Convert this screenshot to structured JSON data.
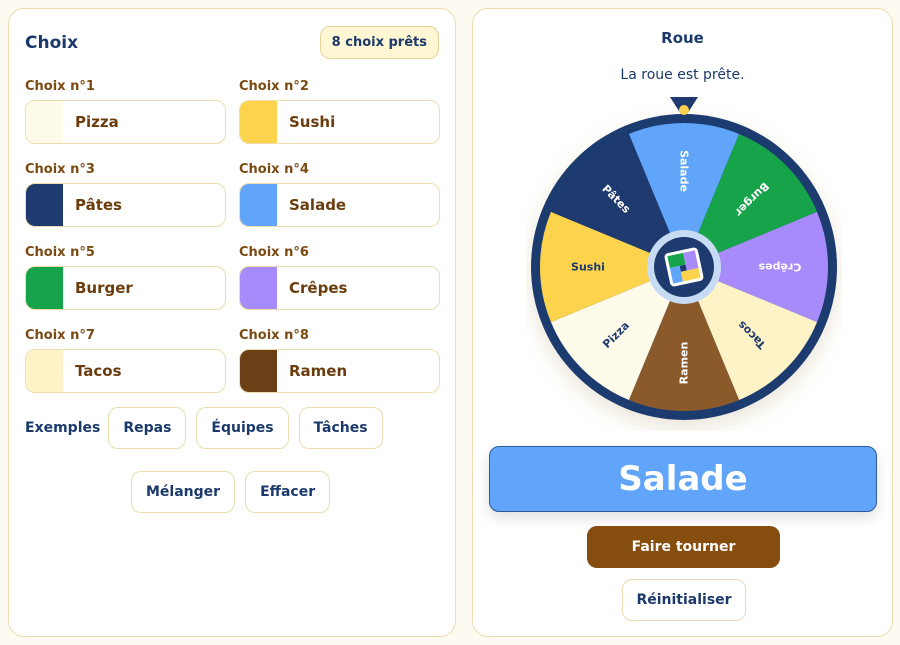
{
  "left_panel": {
    "title": "Choix",
    "badge": "8 choix prêts",
    "choices": [
      {
        "label": "Choix n°1",
        "value": "Pizza",
        "color": "#fffbeb"
      },
      {
        "label": "Choix n°2",
        "value": "Sushi",
        "color": "#fcd34d"
      },
      {
        "label": "Choix n°3",
        "value": "Pâtes",
        "color": "#1e3a6e"
      },
      {
        "label": "Choix n°4",
        "value": "Salade",
        "color": "#60a5fa"
      },
      {
        "label": "Choix n°5",
        "value": "Burger",
        "color": "#16a34a"
      },
      {
        "label": "Choix n°6",
        "value": "Crêpes",
        "color": "#a78bfa"
      },
      {
        "label": "Choix n°7",
        "value": "Tacos",
        "color": "#fef3c7"
      },
      {
        "label": "Choix n°8",
        "value": "Ramen",
        "color": "#6b4016"
      }
    ],
    "examples_label": "Exemples",
    "examples": [
      "Repas",
      "Équipes",
      "Tâches"
    ],
    "shuffle_label": "Mélanger",
    "clear_label": "Effacer"
  },
  "right_panel": {
    "title": "Roue",
    "status": "La roue est prête.",
    "wheel_segments": [
      {
        "label": "Salade",
        "color": "#60a5fa",
        "text_color": "#ffffff"
      },
      {
        "label": "Burger",
        "color": "#16a34a",
        "text_color": "#ffffff"
      },
      {
        "label": "Crêpes",
        "color": "#a78bfa",
        "text_color": "#ffffff"
      },
      {
        "label": "Tacos",
        "color": "#fef3c7",
        "text_color": "#1e3a6e"
      },
      {
        "label": "Ramen",
        "color": "#8b5a2b",
        "text_color": "#ffffff"
      },
      {
        "label": "Pizza",
        "color": "#fffbeb",
        "text_color": "#1e3a6e"
      },
      {
        "label": "Sushi",
        "color": "#fcd34d",
        "text_color": "#1e3a6e"
      },
      {
        "label": "Pâtes",
        "color": "#1e3a6e",
        "text_color": "#ffffff"
      }
    ],
    "rim_color": "#1e3a6e",
    "pointer_color": "#1e3a6e",
    "center_icon": "colorful-square-logo-icon",
    "result": "Salade",
    "spin_label": "Faire tourner",
    "reset_label": "Réinitialiser"
  }
}
